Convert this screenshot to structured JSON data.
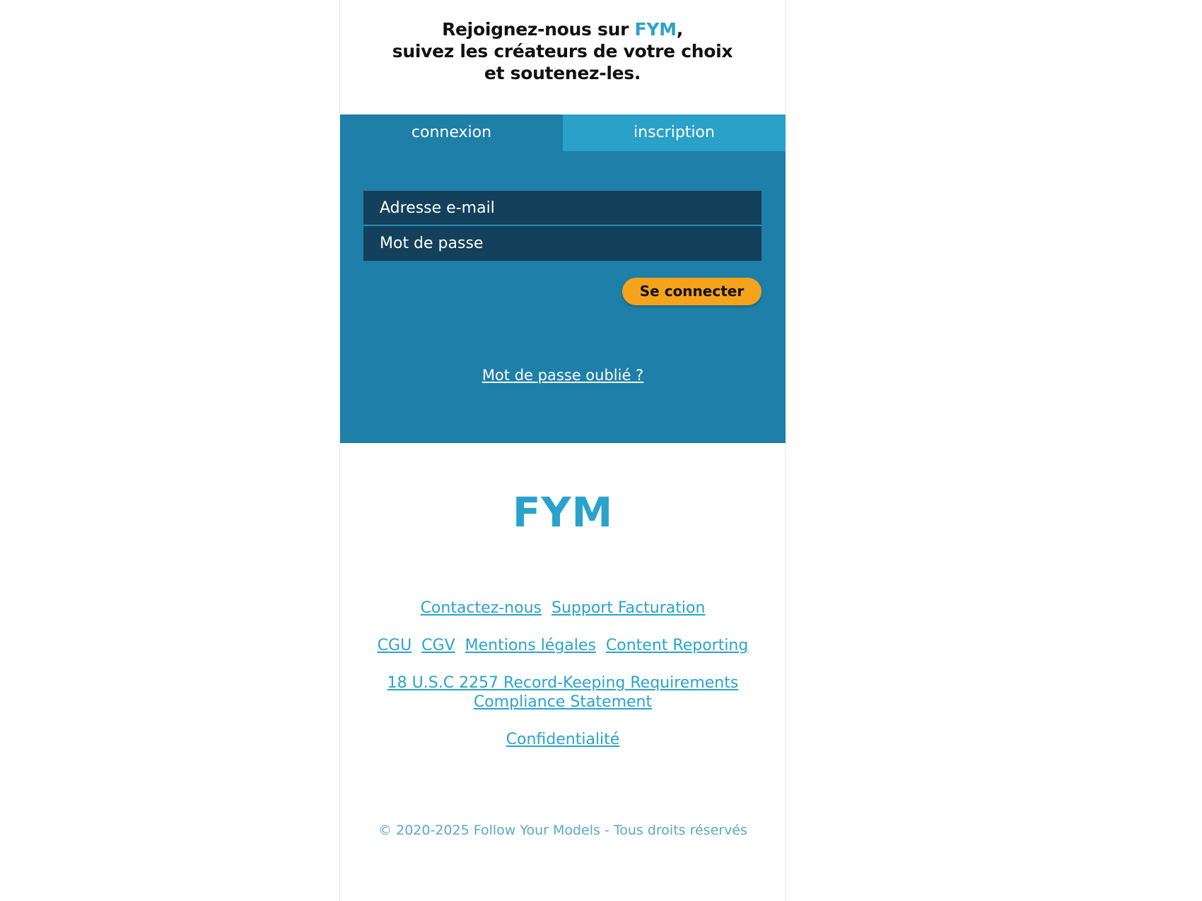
{
  "header": {
    "line1_prefix": "Rejoignez-nous sur ",
    "brand": "FYM",
    "line1_suffix": ",",
    "line2": "suivez les créateurs de votre choix",
    "line3": "et soutenez-les."
  },
  "tabs": {
    "connexion": "connexion",
    "inscription": "inscription"
  },
  "form": {
    "email_placeholder": "Adresse e-mail",
    "password_placeholder": "Mot de passe",
    "submit_label": "Se connecter",
    "forgot_label": "Mot de passe oublié ?"
  },
  "footer": {
    "logo": "FYM",
    "links_row1": [
      "Contactez-nous",
      "Support Facturation"
    ],
    "links_row2": [
      "CGU",
      "CGV",
      "Mentions légales",
      "Content Reporting"
    ],
    "record_keeping_line1": "18 U.S.C 2257 Record-Keeping Requirements",
    "record_keeping_line2": "Compliance Statement",
    "privacy": "Confidentialité",
    "copyright": "© 2020-2025 Follow Your Models - Tous droits réservés"
  },
  "colors": {
    "brand": "#2aa3cc",
    "panel": "#1e7fa8",
    "tab_inactive": "#29a1c9",
    "field_bg": "#13405a",
    "button": "#f5a31a"
  }
}
